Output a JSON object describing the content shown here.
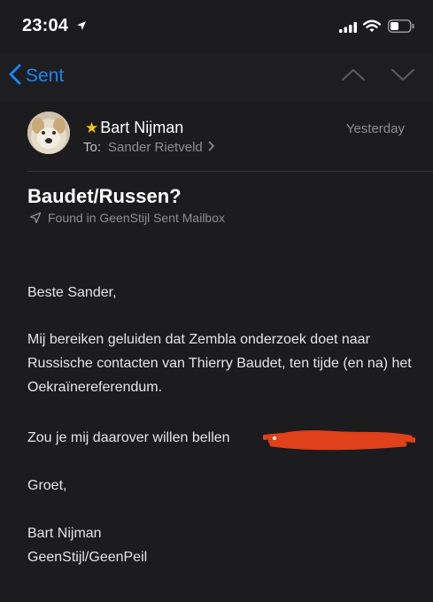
{
  "status_bar": {
    "time": "23:04"
  },
  "nav": {
    "back_label": "Sent"
  },
  "message": {
    "sender": "Bart Nijman",
    "date": "Yesterday",
    "to_label": "To:",
    "recipient": "Sander Rietveld",
    "subject": "Baudet/Russen?",
    "found_in": "Found in GeenStijl Sent Mailbox",
    "greeting": "Beste Sander,",
    "paragraph1": "Mij bereiken geluiden dat Zembla onderzoek doet naar Russische contacten van Thierry Baudet, ten tijde (en na) het Oekraïnereferendum.",
    "paragraph2": "Zou je mij daarover willen bellen",
    "closing": "Groet,",
    "signature_name": "Bart Nijman",
    "signature_org": "GeenStijl/GeenPeil"
  },
  "colors": {
    "accent": "#1a86f5",
    "star": "#f5c518",
    "redaction": "#e0401a",
    "background": "#1c1c1e"
  },
  "icons": [
    "location-arrow-icon",
    "signal-icon",
    "wifi-icon",
    "battery-icon",
    "chevron-left-icon",
    "chevron-up-icon",
    "chevron-down-icon",
    "star-icon",
    "chevron-right-icon",
    "location-icon"
  ]
}
